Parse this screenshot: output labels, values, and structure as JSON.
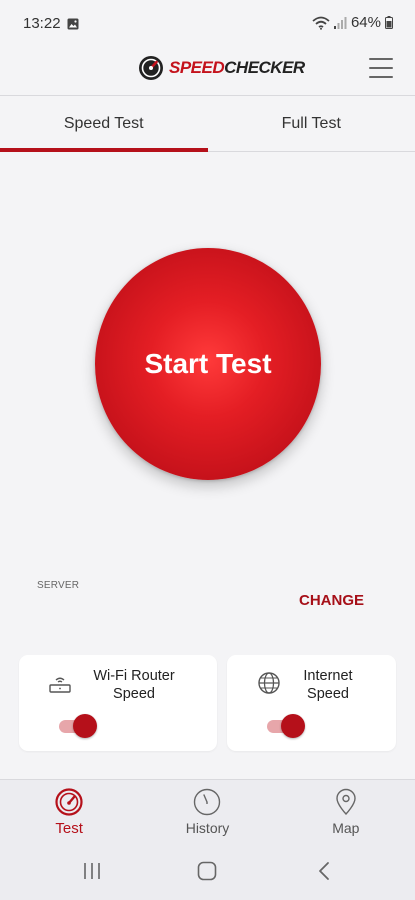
{
  "status_bar": {
    "time": "13:22",
    "battery": "64%"
  },
  "header": {
    "logo_speed": "SPEED",
    "logo_checker": "CHECKER"
  },
  "tabs": [
    {
      "label": "Speed Test",
      "active": true
    },
    {
      "label": "Full Test",
      "active": false
    }
  ],
  "start_button": {
    "label": "Start Test"
  },
  "server": {
    "label": "SERVER",
    "change_label": "CHANGE"
  },
  "cards": {
    "wifi": {
      "label": "Wi-Fi Router Speed",
      "enabled": true
    },
    "internet": {
      "label": "Internet Speed",
      "enabled": true
    }
  },
  "bottom_nav": [
    {
      "label": "Test",
      "icon": "speedometer-icon",
      "active": true
    },
    {
      "label": "History",
      "icon": "clock-icon",
      "active": false
    },
    {
      "label": "Map",
      "icon": "map-pin-icon",
      "active": false
    }
  ],
  "colors": {
    "accent": "#b5101a",
    "background": "#f4f4f6"
  }
}
